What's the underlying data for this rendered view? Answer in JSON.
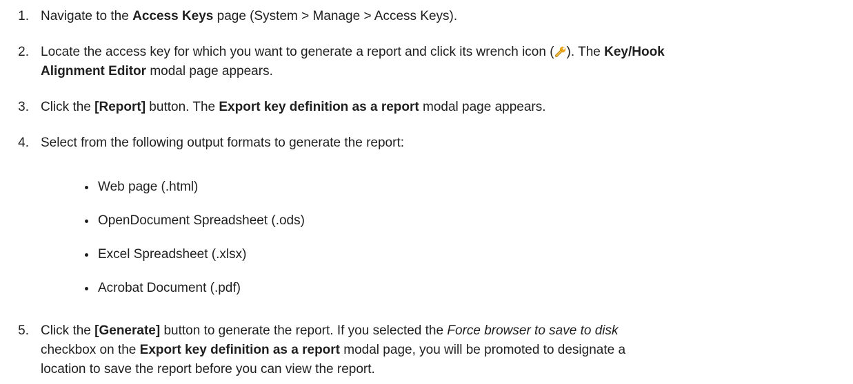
{
  "steps": [
    {
      "num": "1.",
      "pre": "Navigate to the ",
      "bold": "Access Keys",
      "post": " page (System > Manage > Access Keys)."
    },
    {
      "num": "2.",
      "pre": "Locate the access key for which you want to generate a report and click its wrench icon (",
      "mid": "). The ",
      "bold1": "Key/Hook",
      "bold2": "Alignment Editor",
      "post": " modal page appears."
    },
    {
      "num": "3.",
      "pre": "Click the ",
      "bold": "[Report]",
      "mid": " button. The ",
      "bold2": "Export key definition as a report",
      "post": " modal page appears."
    },
    {
      "num": "4.",
      "text": "Select from the following output formats to generate the report:"
    },
    {
      "num": "5.",
      "pre": "Click the ",
      "bold": "[Generate]",
      "mid": " button to generate the report. If you selected the ",
      "italic": "Force browser to save to disk",
      "line2_pre": "checkbox on the ",
      "bold2": "Export key definition as a report",
      "line2_post": " modal page, you will be promoted to designate a",
      "line3": "location to save the report before you can view the report."
    }
  ],
  "formats": [
    "Web page (.html)",
    "OpenDocument Spreadsheet (.ods)",
    "Excel Spreadsheet (.xlsx)",
    "Acrobat Document (.pdf)"
  ],
  "icons": {
    "wrench": "wrench-icon",
    "wrench_color": "#e8a317"
  }
}
